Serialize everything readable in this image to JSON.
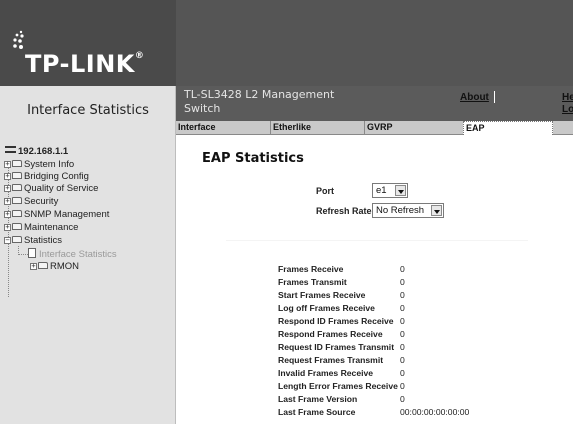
{
  "header": {
    "logo_text": "TP-LINK",
    "logo_reg": "®",
    "product_name": "TL-SL3428 L2 Management Switch",
    "about_label": "About",
    "help_label": "Hel",
    "logout_label": "Logo"
  },
  "section_title": "Interface Statistics",
  "tabs": [
    {
      "label": "Interface"
    },
    {
      "label": "Etherlike"
    },
    {
      "label": "GVRP"
    },
    {
      "label": "EAP"
    }
  ],
  "sidebar": {
    "ip": "192.168.1.1",
    "items": [
      {
        "label": "System Info"
      },
      {
        "label": "Bridging Config"
      },
      {
        "label": "Quality of Service"
      },
      {
        "label": "Security"
      },
      {
        "label": "SNMP Management"
      },
      {
        "label": "Maintenance"
      },
      {
        "label": "Statistics"
      },
      {
        "label": "Interface Statistics"
      },
      {
        "label": "RMON"
      }
    ]
  },
  "main": {
    "title": "EAP Statistics",
    "port_label": "Port",
    "port_value": "e1",
    "refresh_label": "Refresh Rate",
    "refresh_value": "No Refresh",
    "stats": [
      {
        "label": "Frames Receive",
        "value": "0"
      },
      {
        "label": "Frames Transmit",
        "value": "0"
      },
      {
        "label": "Start Frames Receive",
        "value": "0"
      },
      {
        "label": "Log off Frames Receive",
        "value": "0"
      },
      {
        "label": "Respond ID Frames Receive",
        "value": "0"
      },
      {
        "label": "Respond Frames Receive",
        "value": "0"
      },
      {
        "label": "Request ID Frames Transmit",
        "value": "0"
      },
      {
        "label": "Request Frames Transmit",
        "value": "0"
      },
      {
        "label": "Invalid Frames Receive",
        "value": "0"
      },
      {
        "label": "Length Error Frames Receive",
        "value": "0"
      },
      {
        "label": "Last Frame Version",
        "value": "0"
      },
      {
        "label": "Last Frame Source",
        "value": "00:00:00:00:00:00"
      }
    ]
  }
}
